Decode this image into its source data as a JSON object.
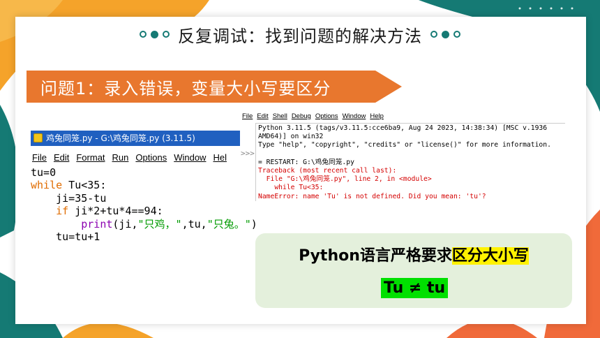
{
  "slide": {
    "title": "反复调试：找到问题的解决方法",
    "banner": "问题1：录入错误，变量大小写要区分"
  },
  "idle_editor": {
    "window_title": "鸡兔同笼.py - G:\\鸡兔同笼.py (3.11.5)",
    "menu": [
      "File",
      "Edit",
      "Format",
      "Run",
      "Options",
      "Window",
      "Hel"
    ],
    "code": [
      [
        {
          "t": "tu=0",
          "c": "plain"
        }
      ],
      [
        {
          "t": "while",
          "c": "kw"
        },
        {
          "t": " Tu<35:",
          "c": "plain"
        }
      ],
      [
        {
          "t": "    ji=35-tu",
          "c": "plain"
        }
      ],
      [
        {
          "t": "    ",
          "c": "plain"
        },
        {
          "t": "if",
          "c": "kw"
        },
        {
          "t": " ji*2+tu*4==94:",
          "c": "plain"
        }
      ],
      [
        {
          "t": "        ",
          "c": "plain"
        },
        {
          "t": "print",
          "c": "bi"
        },
        {
          "t": "(ji,",
          "c": "plain"
        },
        {
          "t": "\"只鸡，\"",
          "c": "str"
        },
        {
          "t": ",tu,",
          "c": "plain"
        },
        {
          "t": "\"只兔。\"",
          "c": "str"
        },
        {
          "t": ")",
          "c": "plain"
        }
      ],
      [
        {
          "t": "    tu=tu+1",
          "c": "plain"
        }
      ]
    ]
  },
  "shell": {
    "prompt_marker": ">>>",
    "menu": [
      "File",
      "Edit",
      "Shell",
      "Debug",
      "Options",
      "Window",
      "Help"
    ],
    "lines": [
      {
        "t": "Python 3.11.5 (tags/v3.11.5:cce6ba9, Aug 24 2023, 14:38:34) [MSC v.1936",
        "c": "plain"
      },
      {
        "t": "AMD64)] on win32",
        "c": "plain"
      },
      {
        "t": "Type \"help\", \"copyright\", \"credits\" or \"license()\" for more information.",
        "c": "plain"
      },
      {
        "t": "",
        "c": "plain"
      },
      {
        "t": "= RESTART: G:\\鸡兔同笼.py",
        "c": "plain"
      },
      {
        "t": "Traceback (most recent call last):",
        "c": "red"
      },
      {
        "t": "  File \"G:\\鸡兔同笼.py\", line 2, in <module>",
        "c": "red"
      },
      {
        "t": "    while Tu<35:",
        "c": "red"
      },
      {
        "t": "NameError: name 'Tu' is not defined. Did you mean: 'tu'?",
        "c": "red"
      }
    ]
  },
  "callout": {
    "line1_prefix": "Python语言严格要求",
    "line1_highlight": "区分大小写",
    "line2": "Tu ≠ tu"
  },
  "colors": {
    "teal": "#157a74",
    "orange": "#e8772e",
    "callout_bg": "#e4f0dc",
    "highlight_yellow": "#fff200",
    "highlight_green": "#00e000"
  }
}
